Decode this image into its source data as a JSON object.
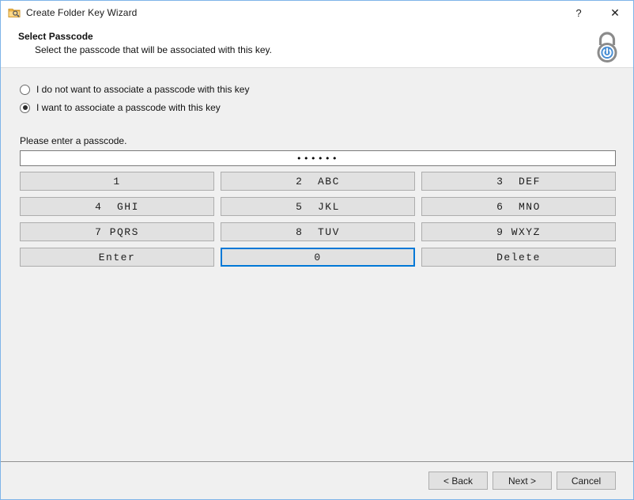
{
  "window": {
    "title": "Create Folder Key Wizard",
    "icon": "folder-key-icon",
    "help_label": "?",
    "close_label": "✕",
    "border_color": "#7eb4e8"
  },
  "header": {
    "title": "Select Passcode",
    "subtitle": "Select the passcode that will be associated with this key.",
    "icon": "padlock-icon"
  },
  "options": [
    {
      "label": "I do not want to associate a passcode with this key",
      "checked": false
    },
    {
      "label": "I want to associate a passcode with this key",
      "checked": true
    }
  ],
  "passcode": {
    "label": "Please enter a passcode.",
    "value": "••••••",
    "masked_length": 6,
    "placeholder": ""
  },
  "keypad": {
    "focused_key": "0",
    "focus_color": "#0078d7",
    "keys": [
      {
        "label": "1",
        "name": "key-1"
      },
      {
        "label": "2  ABC",
        "name": "key-2"
      },
      {
        "label": "3  DEF",
        "name": "key-3"
      },
      {
        "label": "4  GHI",
        "name": "key-4"
      },
      {
        "label": "5  JKL",
        "name": "key-5"
      },
      {
        "label": "6  MNO",
        "name": "key-6"
      },
      {
        "label": "7 PQRS",
        "name": "key-7"
      },
      {
        "label": "8  TUV",
        "name": "key-8"
      },
      {
        "label": "9 WXYZ",
        "name": "key-9"
      },
      {
        "label": "Enter",
        "name": "key-enter"
      },
      {
        "label": "0",
        "name": "key-0"
      },
      {
        "label": "Delete",
        "name": "key-delete"
      }
    ]
  },
  "footer": {
    "back_label": "< Back",
    "next_label": "Next >",
    "cancel_label": "Cancel"
  }
}
